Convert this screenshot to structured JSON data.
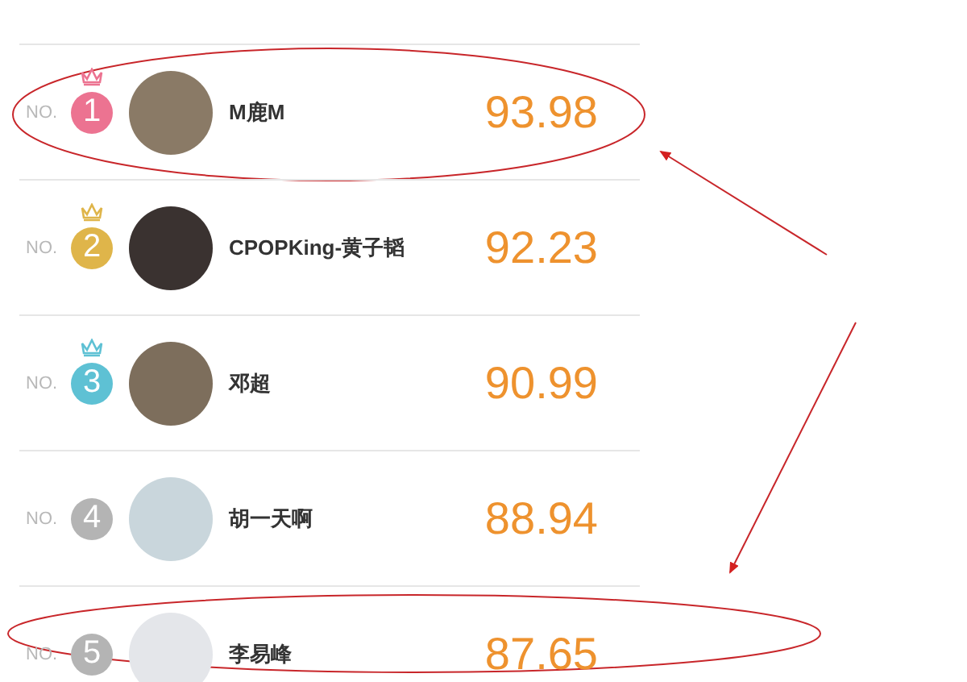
{
  "ranking": {
    "rows": [
      {
        "prefix": "NO.",
        "rank": "1",
        "color": "#ec7391",
        "crown": true,
        "name": "M鹿M",
        "score": "93.98"
      },
      {
        "prefix": "NO.",
        "rank": "2",
        "color": "#dfb54a",
        "crown": true,
        "name": "CPOPKing-黄子韬",
        "score": "92.23"
      },
      {
        "prefix": "NO.",
        "rank": "3",
        "color": "#5ec1d4",
        "crown": true,
        "name": "邓超",
        "score": "90.99"
      },
      {
        "prefix": "NO.",
        "rank": "4",
        "color": "#b4b4b4",
        "crown": false,
        "name": "胡一天啊",
        "score": "88.94"
      },
      {
        "prefix": "NO.",
        "rank": "5",
        "color": "#b4b4b4",
        "crown": false,
        "name": "李易峰",
        "score": "87.65"
      }
    ]
  }
}
